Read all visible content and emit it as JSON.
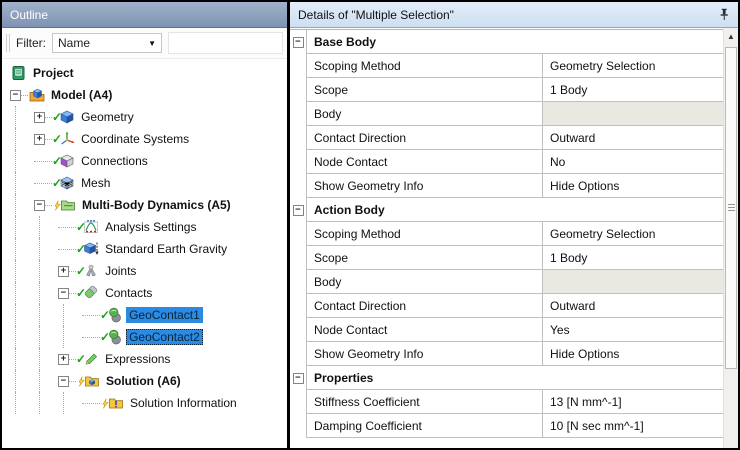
{
  "colors": {
    "selection_blue": "#2B8AE2",
    "empty_cell": "#E9E8E1",
    "outline_titlebar": "#7E93B3",
    "details_titlebar": "#D6E4F4",
    "check_green": "#18A318"
  },
  "outline_panel": {
    "title": "Outline",
    "filter_label": "Filter:",
    "filter_value": "Name",
    "tree": [
      {
        "label": "Project",
        "depth": 0,
        "expander": null,
        "pre": null,
        "icon": "project-icon",
        "bold": true
      },
      {
        "label": "Model (A4)",
        "depth": 1,
        "expander": "minus",
        "pre": null,
        "icon": "model-icon",
        "bold": true
      },
      {
        "label": "Geometry",
        "depth": 2,
        "expander": "plus",
        "pre": "check",
        "icon": "geometry-icon"
      },
      {
        "label": "Coordinate Systems",
        "depth": 2,
        "expander": "plus",
        "pre": "check",
        "icon": "coordinate-systems-icon"
      },
      {
        "label": "Connections",
        "depth": 2,
        "expander": null,
        "pre": "check",
        "icon": "connections-icon"
      },
      {
        "label": "Mesh",
        "depth": 2,
        "expander": null,
        "pre": "check",
        "icon": "mesh-icon"
      },
      {
        "label": "Multi-Body Dynamics (A5)",
        "depth": 2,
        "expander": "minus",
        "pre": "lightning",
        "icon": "environment-folder-icon",
        "bold": true
      },
      {
        "label": "Analysis Settings",
        "depth": 3,
        "expander": null,
        "pre": "check",
        "icon": "analysis-settings-icon"
      },
      {
        "label": "Standard Earth Gravity",
        "depth": 3,
        "expander": null,
        "pre": "check",
        "icon": "gravity-icon"
      },
      {
        "label": "Joints",
        "depth": 3,
        "expander": "plus",
        "pre": "check",
        "icon": "joints-icon"
      },
      {
        "label": "Contacts",
        "depth": 3,
        "expander": "minus",
        "pre": "check",
        "icon": "contacts-icon"
      },
      {
        "label": "GeoContact1",
        "depth": 4,
        "expander": null,
        "pre": "check",
        "icon": "geocontact-icon",
        "selected": true
      },
      {
        "label": "GeoContact2",
        "depth": 4,
        "expander": null,
        "pre": "check",
        "icon": "geocontact-icon",
        "selected": true,
        "focused": true
      },
      {
        "label": "Expressions",
        "depth": 3,
        "expander": "plus",
        "pre": "check",
        "icon": "expressions-icon"
      },
      {
        "label": "Solution (A6)",
        "depth": 3,
        "expander": "minus",
        "pre": "lightning",
        "icon": "solution-folder-icon",
        "bold": true
      },
      {
        "label": "Solution Information",
        "depth": 4,
        "expander": null,
        "pre": "lightning",
        "icon": "solution-info-icon"
      }
    ]
  },
  "details_panel": {
    "title": "Details of \"Multiple Selection\"",
    "sections": [
      {
        "header": "Base Body",
        "rows": [
          {
            "label": "Scoping Method",
            "value": "Geometry Selection"
          },
          {
            "label": "Scope",
            "value": "1 Body"
          },
          {
            "label": "Body",
            "value": "",
            "empty": true
          },
          {
            "label": "Contact Direction",
            "value": "Outward"
          },
          {
            "label": "Node Contact",
            "value": "No"
          },
          {
            "label": "Show Geometry Info",
            "value": "Hide Options"
          }
        ]
      },
      {
        "header": "Action Body",
        "rows": [
          {
            "label": "Scoping Method",
            "value": "Geometry Selection"
          },
          {
            "label": "Scope",
            "value": "1 Body"
          },
          {
            "label": "Body",
            "value": "",
            "empty": true
          },
          {
            "label": "Contact Direction",
            "value": "Outward"
          },
          {
            "label": "Node Contact",
            "value": "Yes"
          },
          {
            "label": "Show Geometry Info",
            "value": "Hide Options"
          }
        ]
      },
      {
        "header": "Properties",
        "rows": [
          {
            "label": "Stiffness Coefficient",
            "value": "13 [N mm^-1]"
          },
          {
            "label": "Damping Coefficient",
            "value": "10 [N sec mm^-1]"
          }
        ]
      }
    ]
  }
}
